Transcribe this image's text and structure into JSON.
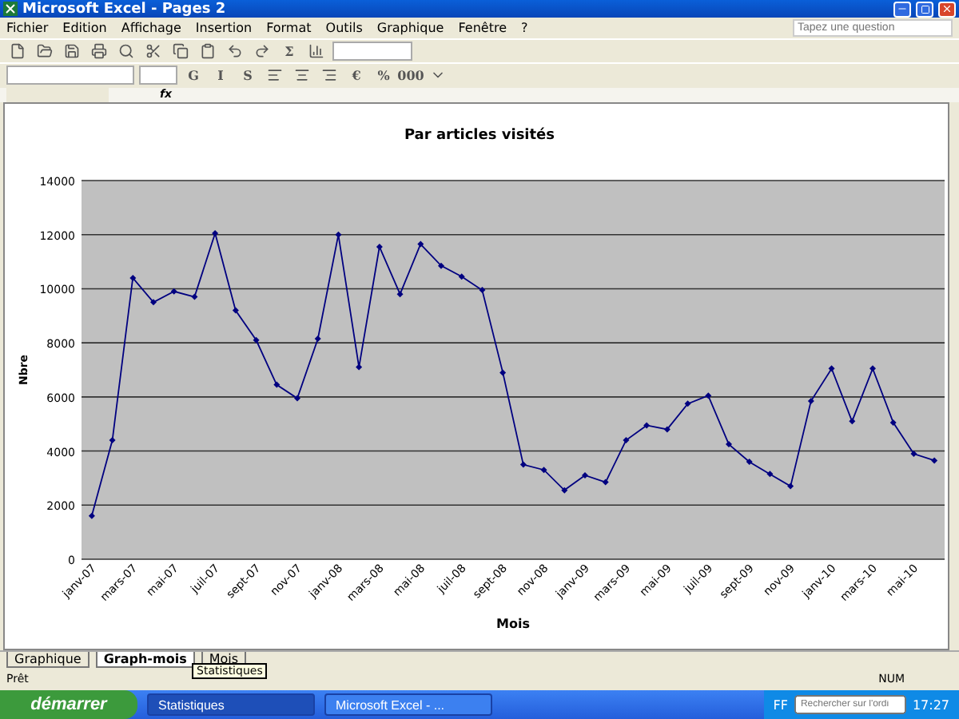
{
  "window": {
    "title": "Microsoft Excel - Pages 2"
  },
  "menu": [
    "Fichier",
    "Edition",
    "Affichage",
    "Insertion",
    "Format",
    "Outils",
    "Graphique",
    "Fenêtre",
    "?"
  ],
  "help": {
    "placeholder": "Tapez une question"
  },
  "format_buttons": [
    "G",
    "I",
    "S"
  ],
  "number_buttons": [
    "€",
    "%",
    "000"
  ],
  "sum_button": "Σ",
  "formula_bar": {
    "fx": "fx"
  },
  "chart": {
    "chart_data": {
      "type": "line",
      "title": "Par articles visités",
      "xlabel": "Mois",
      "ylabel": "Nbre",
      "ylim": [
        0,
        14000
      ],
      "yticks": [
        0,
        2000,
        4000,
        6000,
        8000,
        10000,
        12000,
        14000
      ],
      "grid": true,
      "categories": [
        "janv-07",
        null,
        "mars-07",
        null,
        "mai-07",
        null,
        "juil-07",
        null,
        "sept-07",
        null,
        "nov-07",
        null,
        "janv-08",
        null,
        "mars-08",
        null,
        "mai-08",
        null,
        "juil-08",
        null,
        "sept-08",
        null,
        "nov-08",
        null,
        "janv-09",
        null,
        "mars-09",
        null,
        "mai-09",
        null,
        "juil-09",
        null,
        "sept-09",
        null,
        "nov-09",
        null,
        "janv-10",
        null,
        "mars-10",
        null,
        "mai-10",
        null
      ],
      "series": [
        {
          "color": "#000080",
          "marker": "diamond",
          "values": [
            1600,
            4400,
            10400,
            9500,
            9900,
            9700,
            12050,
            9200,
            8100,
            6450,
            5950,
            8150,
            12000,
            7100,
            11550,
            9800,
            11650,
            10850,
            10450,
            9950,
            6900,
            3500,
            3300,
            2550,
            3100,
            2850,
            4400,
            4950,
            4800,
            5750,
            6050,
            4250,
            3600,
            3150,
            2700,
            5850,
            7050,
            5100,
            7050,
            5050,
            3900,
            3650
          ]
        }
      ]
    }
  },
  "sheet_tabs": [
    {
      "label": "Graphique",
      "selected": false
    },
    {
      "label": "Graph-mois",
      "selected": true
    },
    {
      "label": "Mois",
      "selected": false
    }
  ],
  "tooltip": "Statistiques",
  "status_bar": {
    "left": "Prêt",
    "right": "NUM"
  },
  "taskbar": {
    "start": "démarrer",
    "tasks": [
      {
        "label": "Statistiques",
        "selected": true
      },
      {
        "label": "Microsoft Excel - ...",
        "selected": false
      }
    ],
    "language": "FF",
    "search": {
      "placeholder": "Rechercher sur l'ordi"
    },
    "clock": "17:27"
  }
}
